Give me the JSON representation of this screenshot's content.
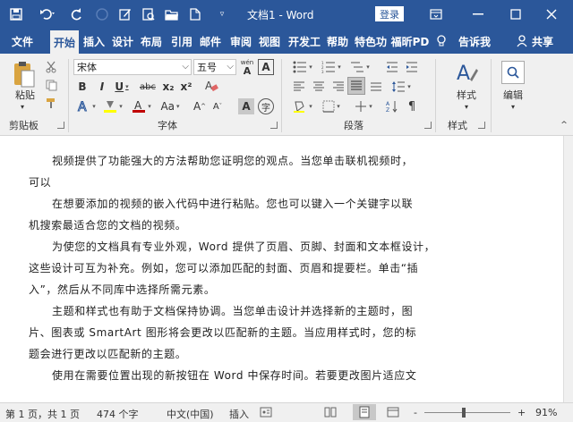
{
  "title_bar": {
    "doc_title": "文档1 - Word",
    "login_label": "登录"
  },
  "tabs": [
    {
      "label": "文件"
    },
    {
      "label": "开始"
    },
    {
      "label": "插入"
    },
    {
      "label": "设计"
    },
    {
      "label": "布局"
    },
    {
      "label": "引用"
    },
    {
      "label": "邮件"
    },
    {
      "label": "审阅"
    },
    {
      "label": "视图"
    },
    {
      "label": "开发工"
    },
    {
      "label": "帮助"
    },
    {
      "label": "特色功"
    },
    {
      "label": "福昕PD"
    },
    {
      "label": "告诉我"
    },
    {
      "label": "共享"
    }
  ],
  "ribbon": {
    "clipboard": {
      "paste_label": "粘贴",
      "group_label": "剪贴板"
    },
    "font": {
      "font_name": "宋体",
      "font_size": "五号",
      "wen_label": "wén",
      "bold": "B",
      "italic": "I",
      "underline": "U",
      "strike": "abc",
      "sub": "x₂",
      "sup": "x²",
      "grow": "A",
      "shrink": "A",
      "case": "Aa",
      "char_border": "A",
      "enclose": "字",
      "group_label": "字体"
    },
    "paragraph": {
      "group_label": "段落"
    },
    "styles": {
      "label": "样式",
      "group_label": "样式"
    },
    "editing": {
      "label": "编辑"
    }
  },
  "document": {
    "paragraphs": [
      [
        "视频提供了功能强大的方法帮助您证明您的观点。当您单击联机视频时，",
        "可以"
      ],
      [
        "在想要添加的视频的嵌入代码中进行粘贴。您也可以键入一个关键字以联",
        "机搜索最适合您的文档的视频。"
      ],
      [
        "为使您的文档具有专业外观，Word 提供了页眉、页脚、封面和文本框设计，",
        "这些设计可互为补充。例如，您可以添加匹配的封面、页眉和提要栏。单击“插",
        "入”，然后从不同库中选择所需元素。"
      ],
      [
        "主题和样式也有助于文档保持协调。当您单击设计并选择新的主题时，图",
        "片、图表或 SmartArt 图形将会更改以匹配新的主题。当应用样式时，您的标",
        "题会进行更改以匹配新的主题。"
      ],
      [
        "使用在需要位置出现的新按钮在 Word 中保存时间。若要更改图片适应文"
      ]
    ]
  },
  "status_bar": {
    "page_info": "第 1 页，共 1 页",
    "word_count": "474 个字",
    "language": "中文(中国)",
    "mode": "插入",
    "zoom_minus": "-",
    "zoom_plus": "+",
    "zoom": "91%",
    "zoom_level": 0.91
  },
  "colors": {
    "accent": "#2b579a",
    "font_color": "#c00000",
    "highlight": "#ffff00"
  }
}
